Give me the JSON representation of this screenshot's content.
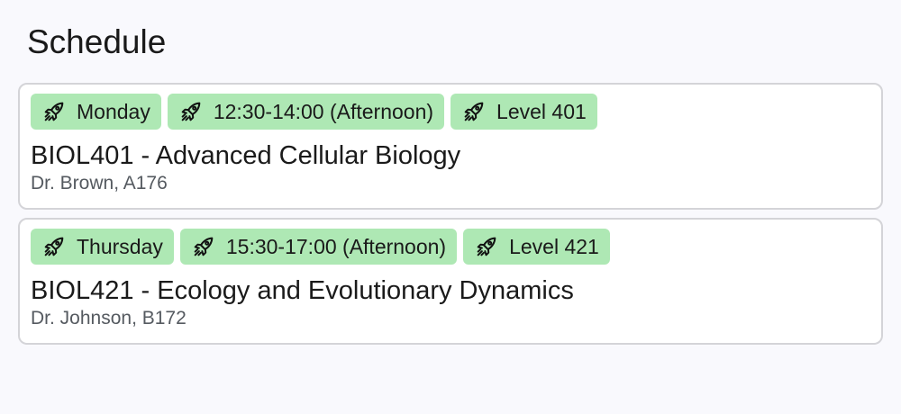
{
  "page": {
    "title": "Schedule"
  },
  "colors": {
    "tag_background": "#aee8b4",
    "card_border": "#d4d4d8",
    "page_background": "#f9f9fd",
    "meta_text": "#555a60"
  },
  "tag_icon": "rocket-icon",
  "courses": [
    {
      "day": "Monday",
      "time": "12:30-14:00 (Afternoon)",
      "level": "Level 401",
      "title": "BIOL401 - Advanced Cellular Biology",
      "meta": "Dr. Brown, A176"
    },
    {
      "day": "Thursday",
      "time": "15:30-17:00 (Afternoon)",
      "level": "Level 421",
      "title": "BIOL421 - Ecology and Evolutionary Dynamics",
      "meta": "Dr. Johnson, B172"
    }
  ]
}
